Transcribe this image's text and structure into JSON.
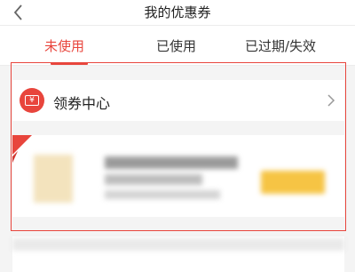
{
  "header": {
    "title": "我的优惠券"
  },
  "tabs": [
    {
      "label": "未使用",
      "active": true
    },
    {
      "label": "已使用",
      "active": false
    },
    {
      "label": "已过期/失效",
      "active": false
    }
  ],
  "coupon_center": {
    "label": "领券中心",
    "icon_text": "¥"
  },
  "colors": {
    "accent": "#e8453c",
    "button": "#f6c444"
  }
}
